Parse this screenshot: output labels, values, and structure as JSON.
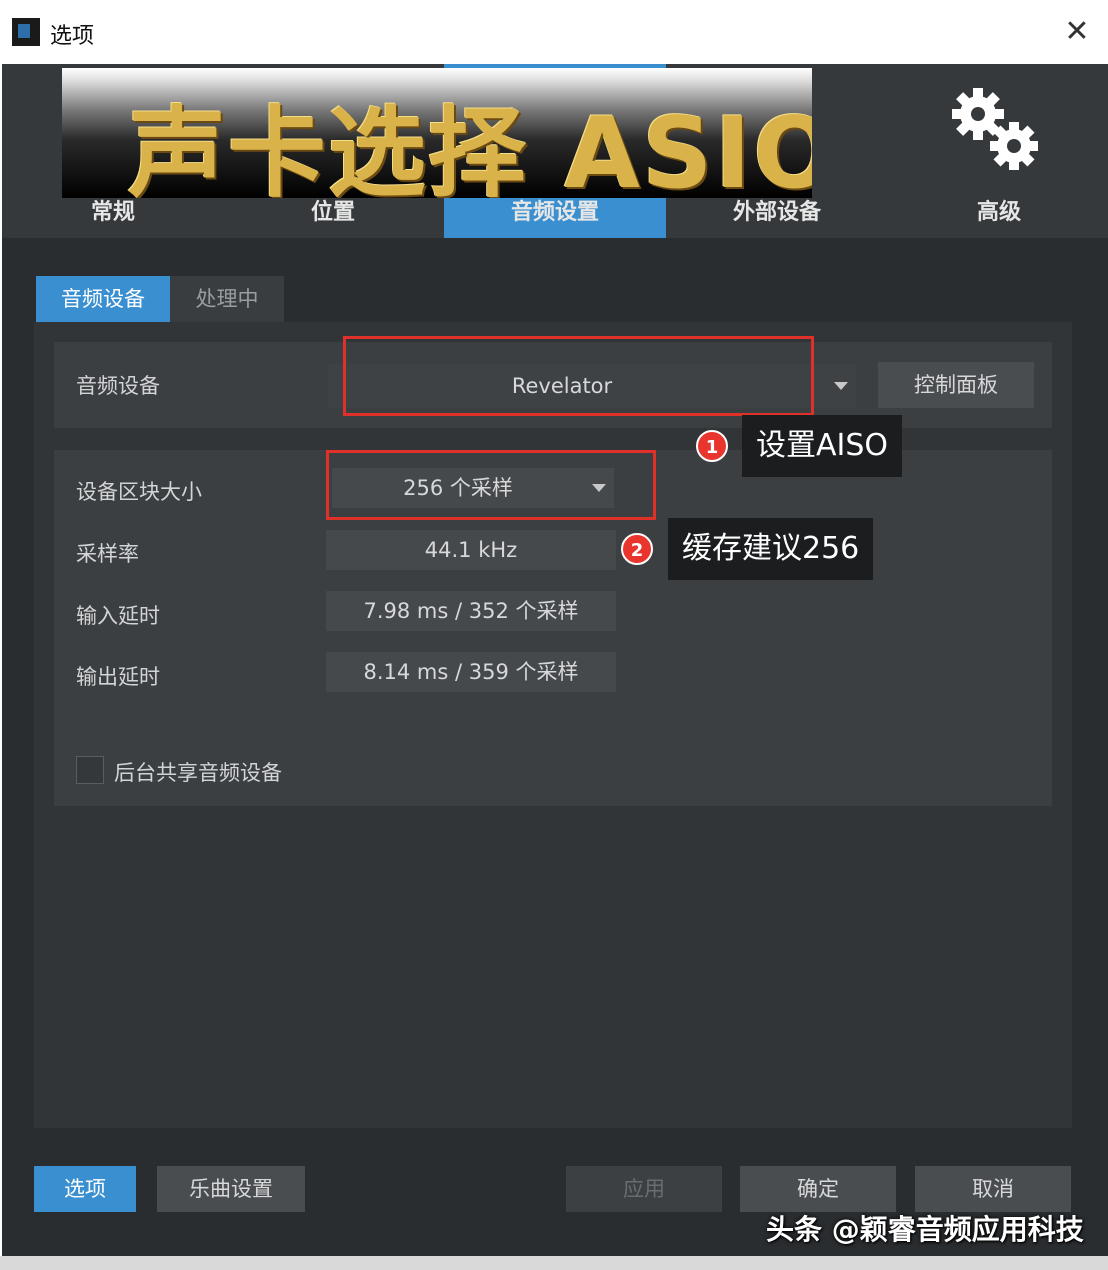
{
  "window": {
    "title": "选项",
    "close_glyph": "✕"
  },
  "banner": {
    "text": "声卡选择 ASIO"
  },
  "categories": [
    {
      "label": "常规"
    },
    {
      "label": "位置"
    },
    {
      "label": "音频设置",
      "selected": true
    },
    {
      "label": "外部设备"
    },
    {
      "label": "高级",
      "icon": "gears-icon"
    }
  ],
  "subtabs": [
    {
      "label": "音频设备",
      "selected": true
    },
    {
      "label": "处理中"
    }
  ],
  "audio_device": {
    "label": "音频设备",
    "value": "Revelator",
    "control_panel_label": "控制面板"
  },
  "settings": {
    "block_size_label": "设备区块大小",
    "block_size_value": "256 个采样",
    "sample_rate_label": "采样率",
    "sample_rate_value": "44.1 kHz",
    "input_latency_label": "输入延时",
    "input_latency_value": "7.98 ms / 352 个采样",
    "output_latency_label": "输出延时",
    "output_latency_value": "8.14 ms / 359 个采样",
    "share_label": "后台共享音频设备",
    "share_checked": false
  },
  "annotations": [
    {
      "number": "1",
      "text": "设置AISO"
    },
    {
      "number": "2",
      "text": "缓存建议256"
    }
  ],
  "buttons": {
    "options": "选项",
    "song_settings": "乐曲设置",
    "apply": "应用",
    "ok": "确定",
    "cancel": "取消"
  },
  "watermark": "头条 @颖睿音频应用科技",
  "colors": {
    "accent": "#3a8fd0",
    "highlight": "#e0302a",
    "background": "#2a2d30"
  }
}
